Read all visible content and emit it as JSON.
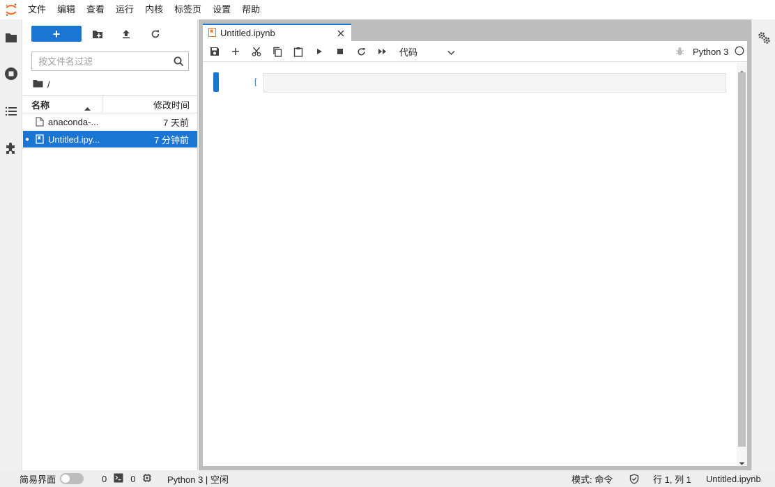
{
  "menubar": {
    "items": [
      "文件",
      "编辑",
      "查看",
      "运行",
      "内核",
      "标签页",
      "设置",
      "帮助"
    ]
  },
  "filebrowser": {
    "new_label": "+",
    "search_placeholder": "按文件名过滤",
    "breadcrumb": "/",
    "col_name": "名称",
    "col_modified": "修改时间",
    "files": [
      {
        "name": "anaconda-...",
        "modified": "7 天前",
        "selected": false,
        "running": false
      },
      {
        "name": "Untitled.ipy...",
        "modified": "7 分钟前",
        "selected": true,
        "running": true
      }
    ]
  },
  "tabs": [
    {
      "label": "Untitled.ipynb",
      "active": true
    }
  ],
  "notebook": {
    "cell_type": "代码",
    "kernel_name": "Python 3",
    "cell_prompt": "[ ]:"
  },
  "statusbar": {
    "simple_label": "简易界面",
    "terminals": "0",
    "kernels": "0",
    "kernel_status": "Python 3 | 空闲",
    "mode": "模式: 命令",
    "cursor": "行 1, 列 1",
    "filename": "Untitled.ipynb"
  },
  "colors": {
    "accent": "#1976d2",
    "notebook_icon": "#f37626"
  }
}
